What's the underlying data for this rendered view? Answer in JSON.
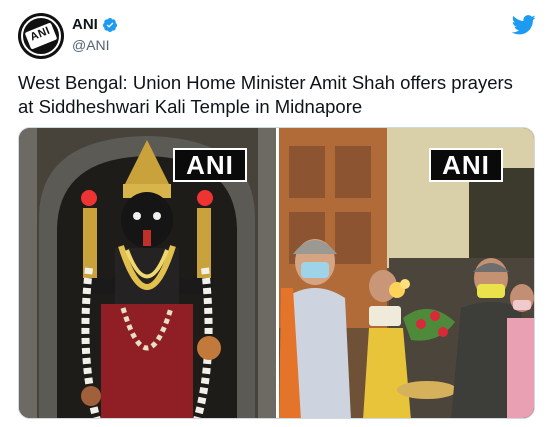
{
  "tweet": {
    "author_name": "ANI",
    "author_handle": "@ANI",
    "avatar_text": "ANI",
    "text": "West Bengal: Union Home Minister Amit Shah offers prayers at Siddheshwari Kali Temple in Midnapore"
  },
  "media": {
    "left_watermark": "ANI",
    "right_watermark": "ANI"
  },
  "colors": {
    "verified_badge": "#1d9bf0",
    "twitter_bird": "#1d9bf0",
    "handle_text": "#536471"
  },
  "icons": {
    "verified": "verified-badge-icon",
    "brand": "twitter-bird-icon"
  }
}
